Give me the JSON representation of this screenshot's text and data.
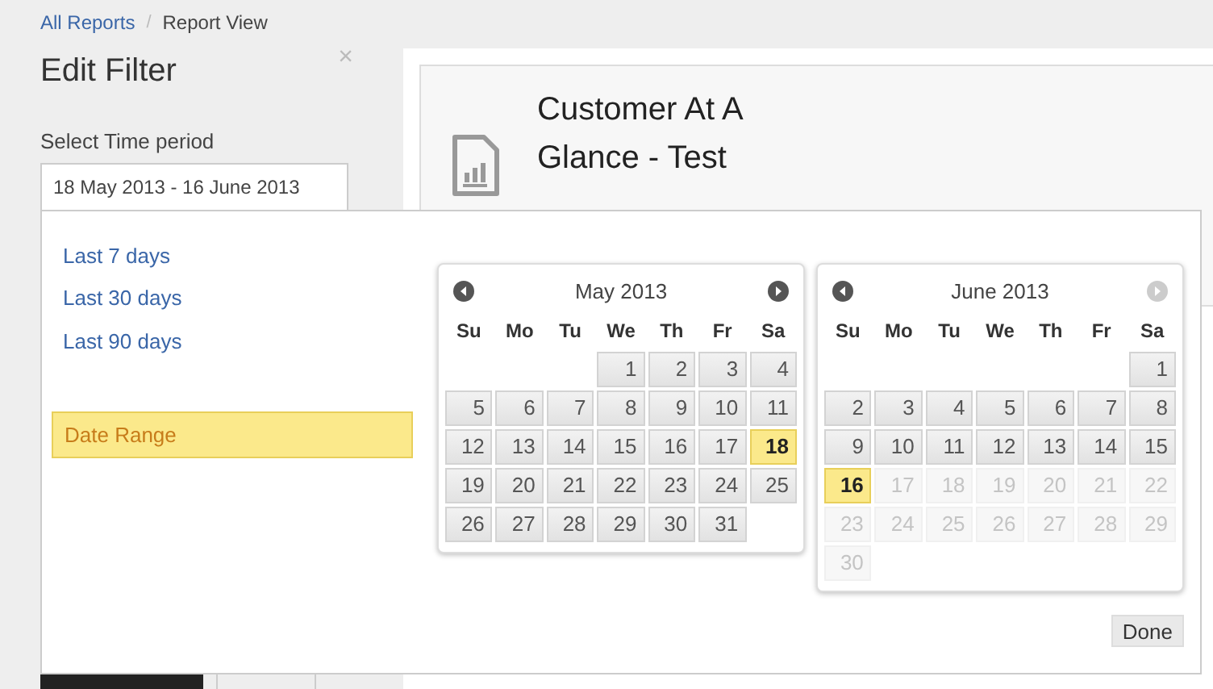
{
  "breadcrumb": [
    {
      "label": "All Reports",
      "link": true
    },
    {
      "label": "Report View",
      "link": false
    }
  ],
  "breadcrumb_separator": "/",
  "filter_panel": {
    "title": "Edit Filter",
    "close": "×",
    "label": "Select Time period",
    "value": "18 May 2013 - 16 June 2013",
    "buttons": [
      {
        "kind": "primary"
      },
      {
        "kind": "secondary"
      }
    ]
  },
  "report_card": {
    "title": "Customer At A Glance - Test"
  },
  "date_picker": {
    "ranges": [
      {
        "label": "Last 7 days",
        "selected": false
      },
      {
        "label": "Last 30 days",
        "selected": false
      },
      {
        "label": "Last 90 days",
        "selected": false
      },
      {
        "label": "Date Range",
        "selected": true
      }
    ],
    "calendars": [
      {
        "title": "May 2013",
        "prev": {
          "disabled": false
        },
        "next": {
          "disabled": false
        },
        "weekdays": [
          "Su",
          "Mo",
          "Tu",
          "We",
          "Th",
          "Fr",
          "Sa"
        ],
        "weeks": [
          [
            {
              "kind": "blank"
            },
            {
              "kind": "blank"
            },
            {
              "kind": "blank"
            },
            {
              "kind": "day",
              "label": "1",
              "selected": false,
              "disabled": false
            },
            {
              "kind": "day",
              "label": "2",
              "selected": false,
              "disabled": false
            },
            {
              "kind": "day",
              "label": "3",
              "selected": false,
              "disabled": false
            },
            {
              "kind": "day",
              "label": "4",
              "selected": false,
              "disabled": false
            }
          ],
          [
            {
              "kind": "day",
              "label": "5",
              "selected": false,
              "disabled": false
            },
            {
              "kind": "day",
              "label": "6",
              "selected": false,
              "disabled": false
            },
            {
              "kind": "day",
              "label": "7",
              "selected": false,
              "disabled": false
            },
            {
              "kind": "day",
              "label": "8",
              "selected": false,
              "disabled": false
            },
            {
              "kind": "day",
              "label": "9",
              "selected": false,
              "disabled": false
            },
            {
              "kind": "day",
              "label": "10",
              "selected": false,
              "disabled": false
            },
            {
              "kind": "day",
              "label": "11",
              "selected": false,
              "disabled": false
            }
          ],
          [
            {
              "kind": "day",
              "label": "12",
              "selected": false,
              "disabled": false
            },
            {
              "kind": "day",
              "label": "13",
              "selected": false,
              "disabled": false
            },
            {
              "kind": "day",
              "label": "14",
              "selected": false,
              "disabled": false
            },
            {
              "kind": "day",
              "label": "15",
              "selected": false,
              "disabled": false
            },
            {
              "kind": "day",
              "label": "16",
              "selected": false,
              "disabled": false
            },
            {
              "kind": "day",
              "label": "17",
              "selected": false,
              "disabled": false
            },
            {
              "kind": "day",
              "label": "18",
              "selected": true,
              "disabled": false
            }
          ],
          [
            {
              "kind": "day",
              "label": "19",
              "selected": false,
              "disabled": false
            },
            {
              "kind": "day",
              "label": "20",
              "selected": false,
              "disabled": false
            },
            {
              "kind": "day",
              "label": "21",
              "selected": false,
              "disabled": false
            },
            {
              "kind": "day",
              "label": "22",
              "selected": false,
              "disabled": false
            },
            {
              "kind": "day",
              "label": "23",
              "selected": false,
              "disabled": false
            },
            {
              "kind": "day",
              "label": "24",
              "selected": false,
              "disabled": false
            },
            {
              "kind": "day",
              "label": "25",
              "selected": false,
              "disabled": false
            }
          ],
          [
            {
              "kind": "day",
              "label": "26",
              "selected": false,
              "disabled": false
            },
            {
              "kind": "day",
              "label": "27",
              "selected": false,
              "disabled": false
            },
            {
              "kind": "day",
              "label": "28",
              "selected": false,
              "disabled": false
            },
            {
              "kind": "day",
              "label": "29",
              "selected": false,
              "disabled": false
            },
            {
              "kind": "day",
              "label": "30",
              "selected": false,
              "disabled": false
            },
            {
              "kind": "day",
              "label": "31",
              "selected": false,
              "disabled": false
            },
            {
              "kind": "blank"
            }
          ]
        ]
      },
      {
        "title": "June 2013",
        "prev": {
          "disabled": false
        },
        "next": {
          "disabled": true
        },
        "weekdays": [
          "Su",
          "Mo",
          "Tu",
          "We",
          "Th",
          "Fr",
          "Sa"
        ],
        "weeks": [
          [
            {
              "kind": "blank"
            },
            {
              "kind": "blank"
            },
            {
              "kind": "blank"
            },
            {
              "kind": "blank"
            },
            {
              "kind": "blank"
            },
            {
              "kind": "blank"
            },
            {
              "kind": "day",
              "label": "1",
              "selected": false,
              "disabled": false
            }
          ],
          [
            {
              "kind": "day",
              "label": "2",
              "selected": false,
              "disabled": false
            },
            {
              "kind": "day",
              "label": "3",
              "selected": false,
              "disabled": false
            },
            {
              "kind": "day",
              "label": "4",
              "selected": false,
              "disabled": false
            },
            {
              "kind": "day",
              "label": "5",
              "selected": false,
              "disabled": false
            },
            {
              "kind": "day",
              "label": "6",
              "selected": false,
              "disabled": false
            },
            {
              "kind": "day",
              "label": "7",
              "selected": false,
              "disabled": false
            },
            {
              "kind": "day",
              "label": "8",
              "selected": false,
              "disabled": false
            }
          ],
          [
            {
              "kind": "day",
              "label": "9",
              "selected": false,
              "disabled": false
            },
            {
              "kind": "day",
              "label": "10",
              "selected": false,
              "disabled": false
            },
            {
              "kind": "day",
              "label": "11",
              "selected": false,
              "disabled": false
            },
            {
              "kind": "day",
              "label": "12",
              "selected": false,
              "disabled": false
            },
            {
              "kind": "day",
              "label": "13",
              "selected": false,
              "disabled": false
            },
            {
              "kind": "day",
              "label": "14",
              "selected": false,
              "disabled": false
            },
            {
              "kind": "day",
              "label": "15",
              "selected": false,
              "disabled": false
            }
          ],
          [
            {
              "kind": "day",
              "label": "16",
              "selected": true,
              "disabled": false
            },
            {
              "kind": "day",
              "label": "17",
              "selected": false,
              "disabled": true
            },
            {
              "kind": "day",
              "label": "18",
              "selected": false,
              "disabled": true
            },
            {
              "kind": "day",
              "label": "19",
              "selected": false,
              "disabled": true
            },
            {
              "kind": "day",
              "label": "20",
              "selected": false,
              "disabled": true
            },
            {
              "kind": "day",
              "label": "21",
              "selected": false,
              "disabled": true
            },
            {
              "kind": "day",
              "label": "22",
              "selected": false,
              "disabled": true
            }
          ],
          [
            {
              "kind": "day",
              "label": "23",
              "selected": false,
              "disabled": true
            },
            {
              "kind": "day",
              "label": "24",
              "selected": false,
              "disabled": true
            },
            {
              "kind": "day",
              "label": "25",
              "selected": false,
              "disabled": true
            },
            {
              "kind": "day",
              "label": "26",
              "selected": false,
              "disabled": true
            },
            {
              "kind": "day",
              "label": "27",
              "selected": false,
              "disabled": true
            },
            {
              "kind": "day",
              "label": "28",
              "selected": false,
              "disabled": true
            },
            {
              "kind": "day",
              "label": "29",
              "selected": false,
              "disabled": true
            }
          ],
          [
            {
              "kind": "day",
              "label": "30",
              "selected": false,
              "disabled": true
            },
            {
              "kind": "blank"
            },
            {
              "kind": "blank"
            },
            {
              "kind": "blank"
            },
            {
              "kind": "blank"
            },
            {
              "kind": "blank"
            },
            {
              "kind": "blank"
            }
          ]
        ]
      }
    ],
    "done": "Done"
  }
}
